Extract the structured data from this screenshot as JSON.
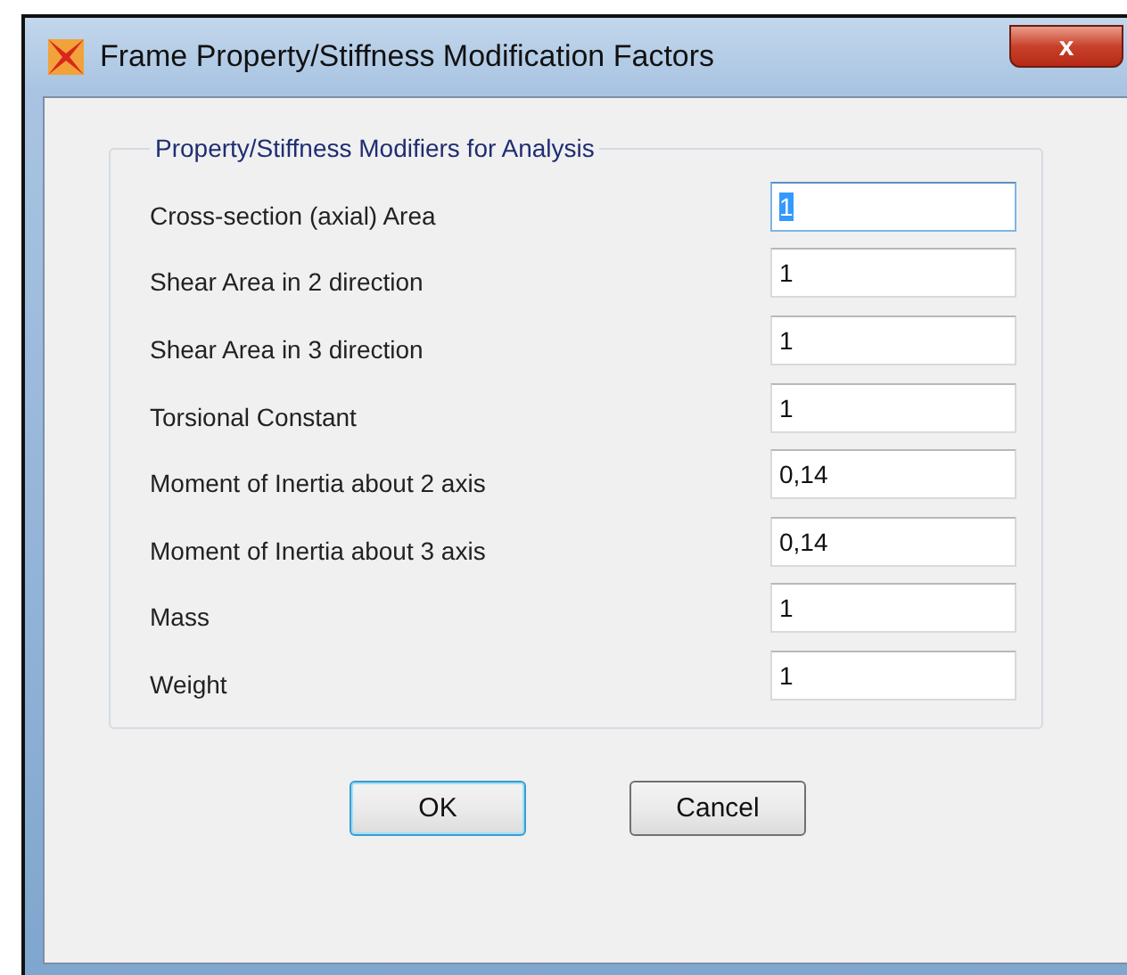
{
  "window": {
    "title": "Frame Property/Stiffness Modification Factors",
    "close_label": "x"
  },
  "group": {
    "title": "Property/Stiffness Modifiers for Analysis",
    "rows": [
      {
        "label": "Cross-section (axial) Area",
        "value": "1",
        "focused": true
      },
      {
        "label": "Shear Area in 2 direction",
        "value": "1",
        "focused": false
      },
      {
        "label": "Shear Area in 3 direction",
        "value": "1",
        "focused": false
      },
      {
        "label": "Torsional Constant",
        "value": "1",
        "focused": false
      },
      {
        "label": "Moment of Inertia about 2 axis",
        "value": "0,14",
        "focused": false
      },
      {
        "label": "Moment of Inertia about 3 axis",
        "value": "0,14",
        "focused": false
      },
      {
        "label": "Mass",
        "value": "1",
        "focused": false
      },
      {
        "label": "Weight",
        "value": "1",
        "focused": false
      }
    ]
  },
  "buttons": [
    {
      "label": "OK",
      "default": true
    },
    {
      "label": "Cancel",
      "default": false
    }
  ]
}
